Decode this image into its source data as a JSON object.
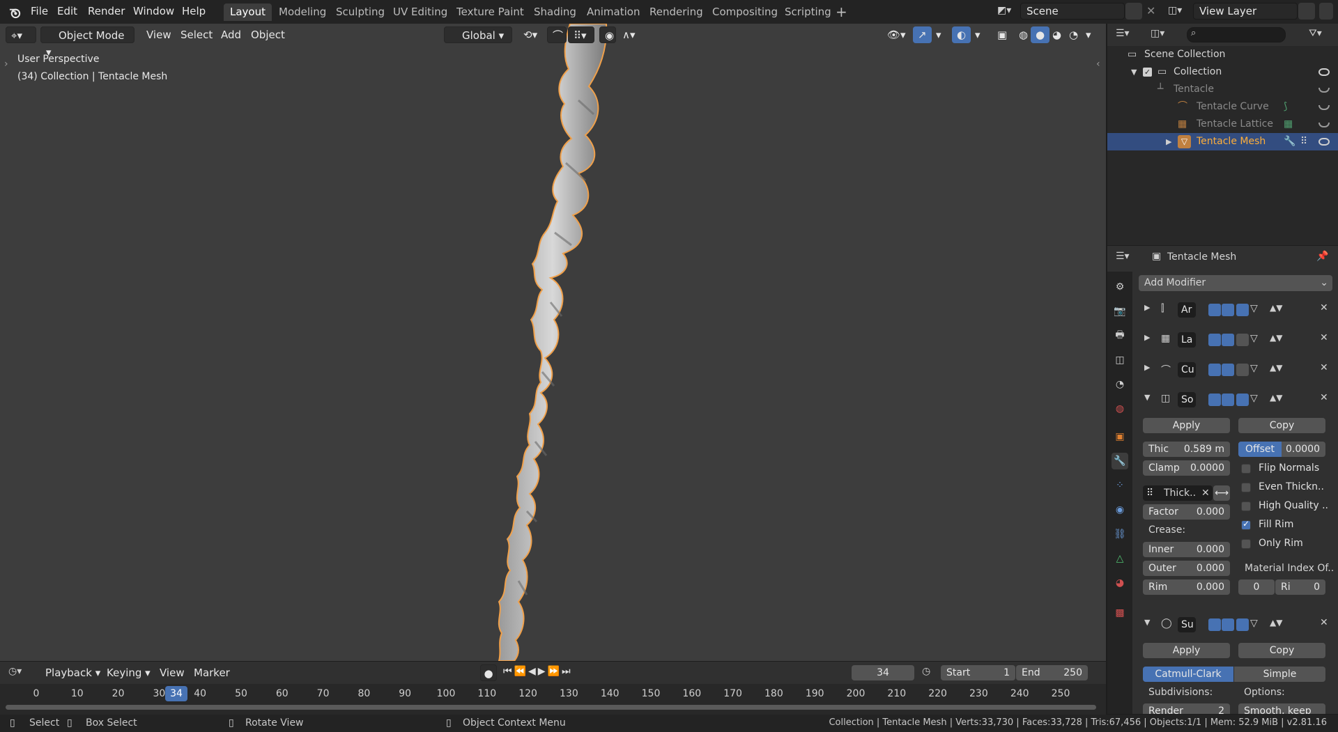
{
  "app": {
    "accent": "#4772b3",
    "selection_color": "#334d80"
  },
  "menu": [
    "File",
    "Edit",
    "Render",
    "Window",
    "Help"
  ],
  "workspaces": [
    "Layout",
    "Modeling",
    "Sculpting",
    "UV Editing",
    "Texture Paint",
    "Shading",
    "Animation",
    "Rendering",
    "Compositing",
    "Scripting"
  ],
  "active_workspace": "Layout",
  "scene": {
    "name": "Scene",
    "view_layer": "View Layer"
  },
  "viewport": {
    "mode": "Object Mode",
    "menus": [
      "View",
      "Select",
      "Add",
      "Object"
    ],
    "orientation": "Global",
    "overlay_title": "User Perspective",
    "overlay_subtitle": "(34) Collection | Tentacle Mesh"
  },
  "outliner": {
    "search_placeholder": "",
    "items": [
      {
        "label": "Scene Collection",
        "icon": "scene-collection-icon"
      },
      {
        "label": "Collection",
        "icon": "collection-icon"
      },
      {
        "label": "Tentacle",
        "icon": "empty-icon"
      },
      {
        "label": "Tentacle Curve",
        "icon": "curve-icon"
      },
      {
        "label": "Tentacle Lattice",
        "icon": "lattice-icon"
      },
      {
        "label": "Tentacle Mesh",
        "icon": "mesh-icon",
        "selected": true
      }
    ]
  },
  "properties": {
    "object_name": "Tentacle Mesh",
    "add_modifier": "Add Modifier",
    "modifiers": [
      {
        "short": "Ar",
        "icon": "armature-modifier-icon"
      },
      {
        "short": "La",
        "icon": "lattice-modifier-icon"
      },
      {
        "short": "Cu",
        "icon": "curve-modifier-icon"
      },
      {
        "short": "So",
        "icon": "solidify-modifier-icon"
      },
      {
        "short": "Su",
        "icon": "subsurf-modifier-icon"
      }
    ],
    "solidify": {
      "apply": "Apply",
      "copy": "Copy",
      "thickness_label": "Thic",
      "thickness_value": "0.589 m",
      "offset_label": "Offset",
      "offset_value": "0.0000",
      "clamp_label": "Clamp",
      "clamp_value": "0.0000",
      "vgroup_label": "Thick..",
      "factor_label": "Factor",
      "factor_value": "0.000",
      "crease_label": "Crease:",
      "inner_label": "Inner",
      "inner_value": "0.000",
      "outer_label": "Outer",
      "outer_value": "0.000",
      "rim_label": "Rim",
      "rim_value": "0.000",
      "flip_normals": "Flip Normals",
      "even_thickness": "Even Thickn..",
      "high_quality": "High Quality ..",
      "fill_rim": "Fill Rim",
      "only_rim": "Only Rim",
      "fill_rim_checked": true,
      "material_index_label": "Material Index Of..",
      "material_index_value": "0",
      "material_rim_label": "Ri",
      "material_rim_value": "0"
    },
    "subsurf": {
      "apply": "Apply",
      "copy": "Copy",
      "catmull": "Catmull-Clark",
      "simple": "Simple",
      "subdivisions": "Subdivisions:",
      "options": "Options:",
      "render_label": "Render",
      "render_value": "2",
      "smooth_label": "Smooth, keep .."
    }
  },
  "timeline": {
    "menus": [
      "Playback",
      "Keying",
      "View",
      "Marker"
    ],
    "current_frame": "34",
    "start_label": "Start",
    "start_value": "1",
    "end_label": "End",
    "end_value": "250",
    "ticks": [
      "0",
      "10",
      "20",
      "30",
      "40",
      "50",
      "60",
      "70",
      "80",
      "90",
      "100",
      "110",
      "120",
      "130",
      "140",
      "150",
      "160",
      "170",
      "180",
      "190",
      "200",
      "210",
      "220",
      "230",
      "240",
      "250"
    ]
  },
  "statusbar": {
    "select": "Select",
    "box_select": "Box Select",
    "rotate_view": "Rotate View",
    "context_menu": "Object Context Menu",
    "stats": "Collection | Tentacle Mesh | Verts:33,730 | Faces:33,728 | Tris:67,456 | Objects:1/1 | Mem: 52.9 MiB | v2.81.16"
  }
}
